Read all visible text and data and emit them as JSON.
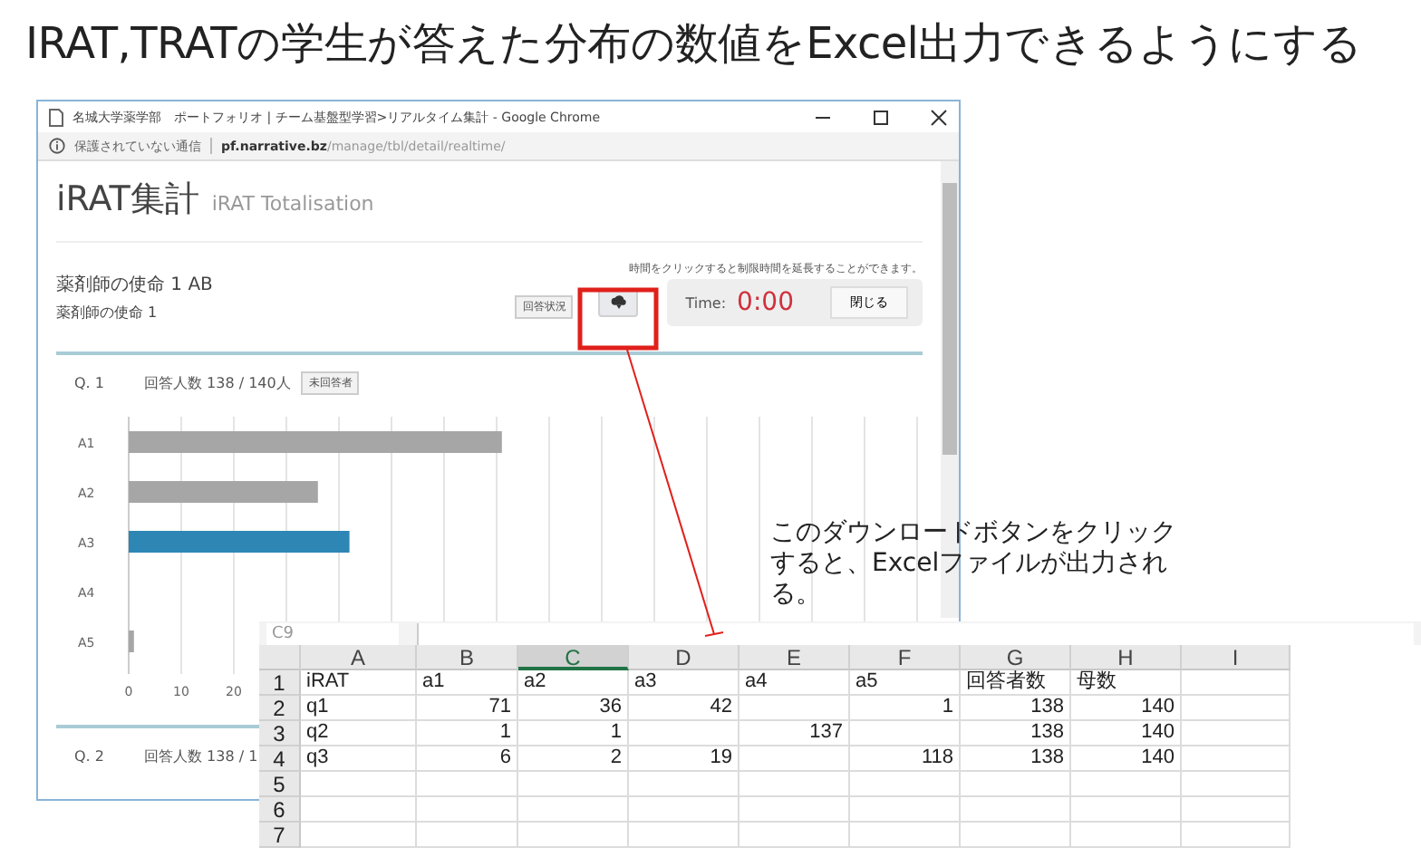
{
  "slide_title": "IRAT,TRATの学生が答えた分布の数値をExcel出力できるようにする",
  "browser": {
    "title": "名城大学薬学部　ポートフォリオ | チーム基盤型学習>リアルタイム集計 - Google Chrome",
    "security": "保護されていない通信",
    "url_host": "pf.narrative.bz",
    "url_path": "/manage/tbl/detail/realtime/",
    "page": {
      "heading": "iRAT集計",
      "subheading": "iRAT Totalisation",
      "session_title": "薬剤師の使命 1 AB",
      "session_subtitle": "薬剤師の使命 1",
      "hint": "時間をクリックすると制限時間を延長することができます。",
      "status_button": "回答状況",
      "timer_label": "Time:",
      "timer_value": "0:00",
      "close_button": "閉じる",
      "questions": [
        {
          "number": "Q. 1",
          "answered": "回答人数 138 / 140人",
          "unanswered_button": "未回答者",
          "chart_data": {
            "type": "bar",
            "orientation": "horizontal",
            "stacked": true,
            "categories": [
              "A1",
              "A2",
              "A3",
              "A4",
              "A5"
            ],
            "series": [
              {
                "color": "#a6a6a6",
                "values": [
                  71,
                  36,
                  null,
                  0,
                  1
                ]
              },
              {
                "color": "#2e86b4",
                "values": [
                  null,
                  null,
                  42,
                  null,
                  null
                ]
              }
            ],
            "xlim": [
              0,
              150
            ],
            "xticks": [
              0,
              10,
              20
            ]
          }
        },
        {
          "number": "Q. 2",
          "answered": "回答人数 138 / 1"
        }
      ]
    }
  },
  "callout": [
    "このダウンロードボタンをクリック",
    "すると、Excelファイルが出力され",
    "る。"
  ],
  "spreadsheet": {
    "name_box": "C9",
    "columns": [
      {
        "label": "A",
        "selected": false
      },
      {
        "label": "B",
        "selected": false
      },
      {
        "label": "C",
        "selected": true
      },
      {
        "label": "D",
        "selected": false
      },
      {
        "label": "E",
        "selected": false
      },
      {
        "label": "F",
        "selected": false
      },
      {
        "label": "G",
        "selected": false
      },
      {
        "label": "H",
        "selected": false
      },
      {
        "label": "I",
        "selected": false
      }
    ],
    "rows": [
      {
        "number": "1",
        "cells": [
          "iRAT",
          "a1",
          "a2",
          "a3",
          "a4",
          "a5",
          "回答者数",
          "母数",
          null
        ]
      },
      {
        "number": "2",
        "cells": [
          "q1",
          "71",
          "36",
          "42",
          null,
          "1",
          "138",
          "140",
          null
        ]
      },
      {
        "number": "3",
        "cells": [
          "q2",
          "1",
          "1",
          null,
          "137",
          null,
          "138",
          "140",
          null
        ]
      },
      {
        "number": "4",
        "cells": [
          "q3",
          "6",
          "2",
          "19",
          null,
          "118",
          "138",
          "140",
          null
        ]
      },
      {
        "number": "5",
        "cells": []
      },
      {
        "number": "6",
        "cells": []
      },
      {
        "number": "7",
        "cells": []
      }
    ]
  }
}
